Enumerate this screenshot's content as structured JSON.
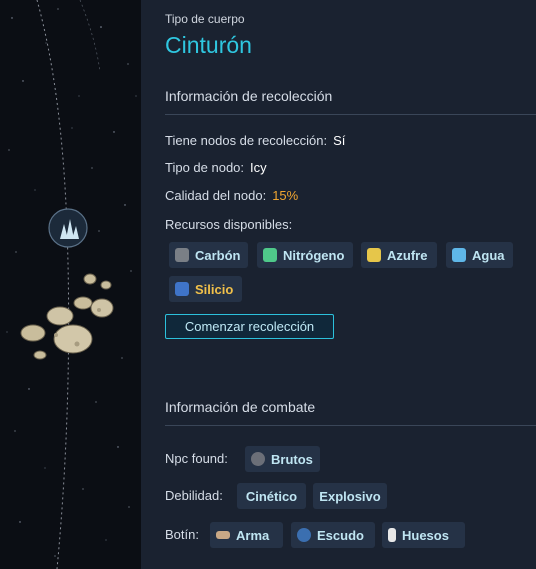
{
  "body": {
    "type_label": "Tipo de cuerpo",
    "type_value": "Cinturón"
  },
  "gathering": {
    "title": "Información de recolección",
    "has_nodes_label": "Tiene nodos de recolección:",
    "has_nodes_value": "Sí",
    "node_type_label": "Tipo de nodo:",
    "node_type_value": "Icy",
    "node_quality_label": "Calidad del nodo:",
    "node_quality_value": "15%",
    "resources_label": "Recursos disponibles:",
    "resources": [
      {
        "name": "Carbón",
        "icon": "carbon-icon",
        "color": "#7a7f86"
      },
      {
        "name": "Nitrógeno",
        "icon": "nitrogen-icon",
        "color": "#4fc98a"
      },
      {
        "name": "Azufre",
        "icon": "sulfur-icon",
        "color": "#e6c64a"
      },
      {
        "name": "Agua",
        "icon": "water-icon",
        "color": "#5fb7e8"
      },
      {
        "name": "Silicio",
        "icon": "silicon-icon",
        "color": "#3f74c8"
      }
    ],
    "button_label": "Comenzar recolección"
  },
  "combat": {
    "title": "Información de combate",
    "npc_label": "Npc found:",
    "npc_value": "Brutos",
    "weakness_label": "Debilidad:",
    "weaknesses": [
      "Cinético",
      "Explosivo"
    ],
    "loot_label": "Botín:",
    "loot": [
      {
        "name": "Arma",
        "icon": "weapon-icon"
      },
      {
        "name": "Escudo",
        "icon": "shield-icon"
      },
      {
        "name": "Huesos",
        "icon": "bones-icon"
      }
    ]
  },
  "colors": {
    "accent": "#2fc7e0",
    "quality": "#f0a531",
    "panel_bg": "#1a2230",
    "chip_bg": "#253246"
  }
}
